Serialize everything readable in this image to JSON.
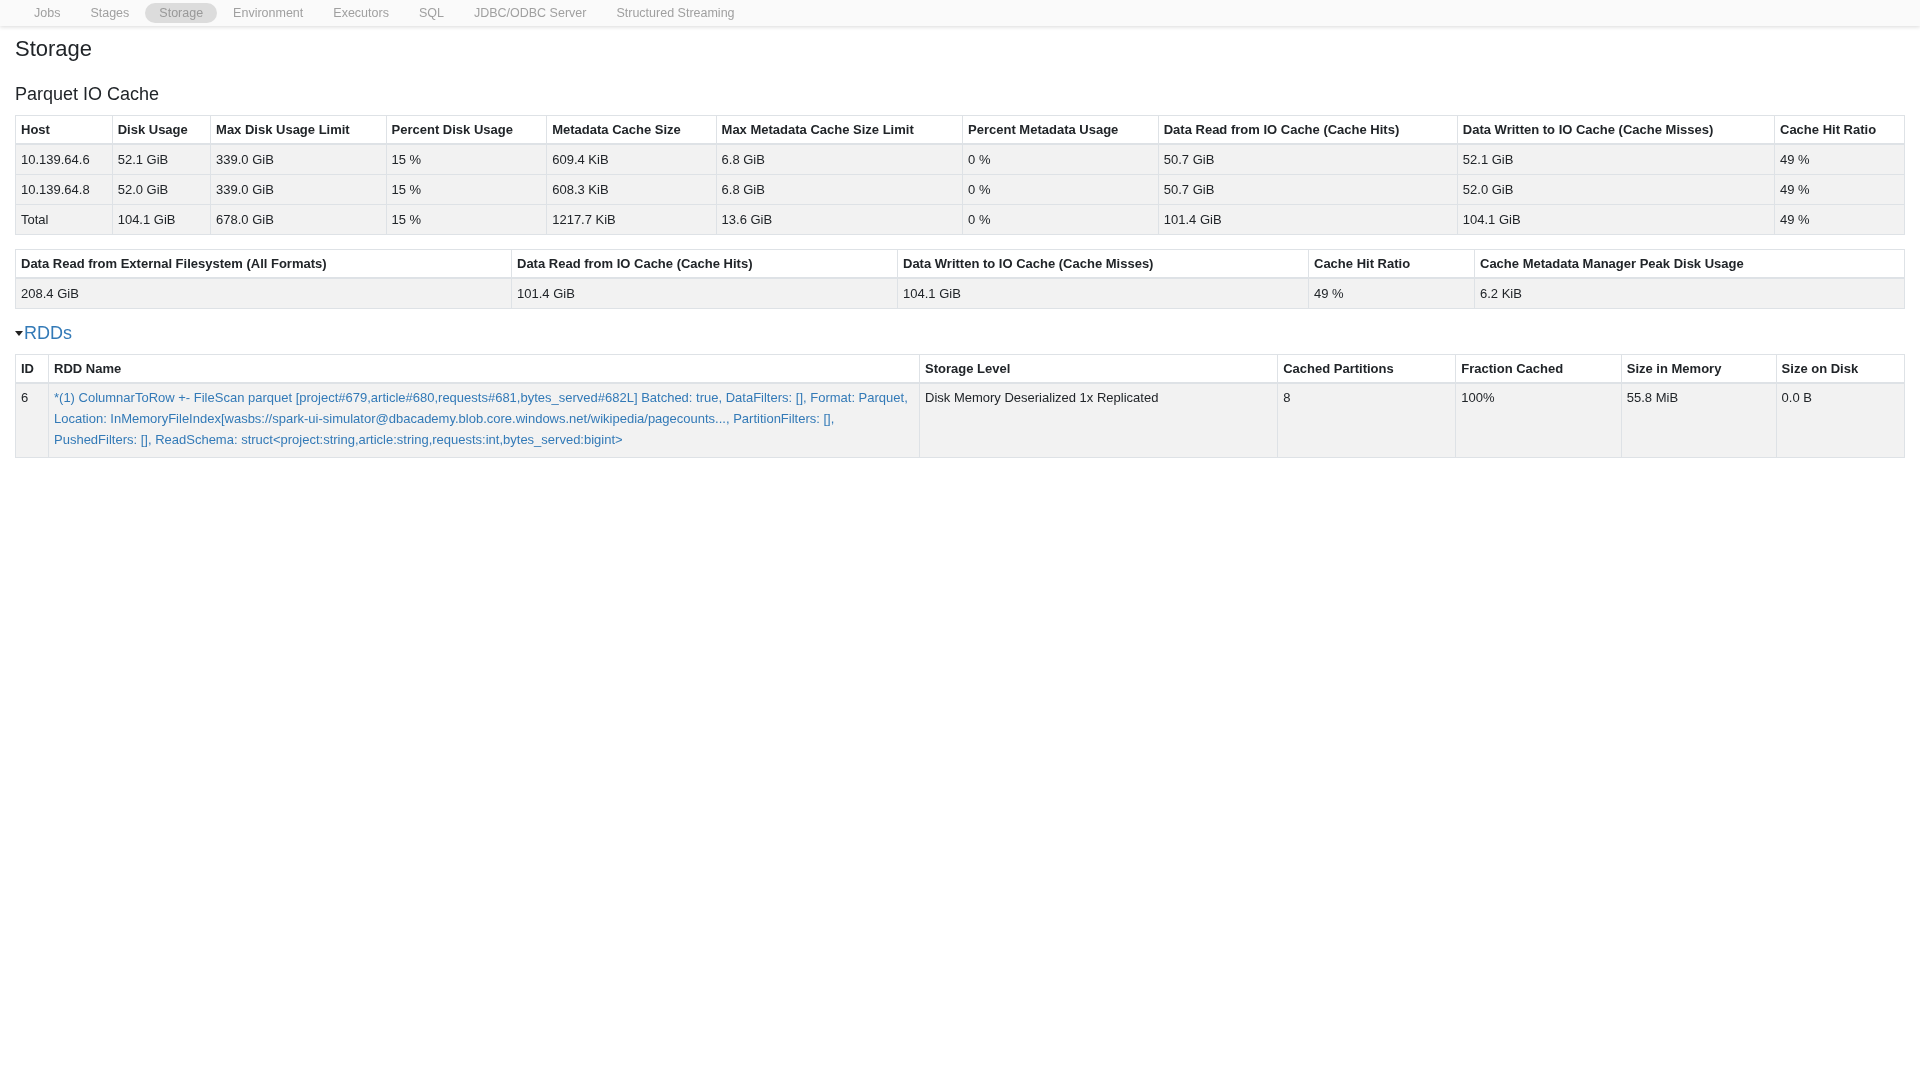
{
  "nav": {
    "tabs": [
      {
        "label": "Jobs",
        "selected": false
      },
      {
        "label": "Stages",
        "selected": false
      },
      {
        "label": "Storage",
        "selected": true
      },
      {
        "label": "Environment",
        "selected": false
      },
      {
        "label": "Executors",
        "selected": false
      },
      {
        "label": "SQL",
        "selected": false
      },
      {
        "label": "JDBC/ODBC Server",
        "selected": false
      },
      {
        "label": "Structured Streaming",
        "selected": false
      }
    ]
  },
  "title": "Storage",
  "io_cache": {
    "heading": "Parquet IO Cache",
    "table": {
      "columns": [
        "Host",
        "Disk Usage",
        "Max Disk Usage Limit",
        "Percent Disk Usage",
        "Metadata Cache Size",
        "Max Metadata Cache Size Limit",
        "Percent Metadata Usage",
        "Data Read from IO Cache (Cache Hits)",
        "Data Written to IO Cache (Cache Misses)",
        "Cache Hit Ratio"
      ],
      "rows": [
        [
          "10.139.64.6",
          "52.1 GiB",
          "339.0 GiB",
          "15 %",
          "609.4 KiB",
          "6.8 GiB",
          "0 %",
          "50.7 GiB",
          "52.1 GiB",
          "49 %"
        ],
        [
          "10.139.64.8",
          "52.0 GiB",
          "339.0 GiB",
          "15 %",
          "608.3 KiB",
          "6.8 GiB",
          "0 %",
          "50.7 GiB",
          "52.0 GiB",
          "49 %"
        ],
        [
          "Total",
          "104.1 GiB",
          "678.0 GiB",
          "15 %",
          "1217.7 KiB",
          "13.6 GiB",
          "0 %",
          "101.4 GiB",
          "104.1 GiB",
          "49 %"
        ]
      ]
    },
    "summary": {
      "columns": [
        "Data Read from External Filesystem (All Formats)",
        "Data Read from IO Cache (Cache Hits)",
        "Data Written to IO Cache (Cache Misses)",
        "Cache Hit Ratio",
        "Cache Metadata Manager Peak Disk Usage"
      ],
      "rows": [
        [
          "208.4 GiB",
          "101.4 GiB",
          "104.1 GiB",
          "49 %",
          "6.2 KiB"
        ]
      ]
    }
  },
  "rdds": {
    "heading": "RDDs",
    "expanded": true,
    "table": {
      "columns": [
        "ID",
        "RDD Name",
        "Storage Level",
        "Cached Partitions",
        "Fraction Cached",
        "Size in Memory",
        "Size on Disk"
      ],
      "rows": [
        {
          "id": "6",
          "name": "*(1) ColumnarToRow +- FileScan parquet [project#679,article#680,requests#681,bytes_served#682L] Batched: true, DataFilters: [], Format: Parquet, Location: InMemoryFileIndex[wasbs://spark-ui-simulator@dbacademy.blob.core.windows.net/wikipedia/pagecounts..., PartitionFilters: [], PushedFilters: [], ReadSchema: struct<project:string,article:string,requests:int,bytes_served:bigint>",
          "storage_level": "Disk Memory Deserialized 1x Replicated",
          "cached_partitions": "8",
          "fraction_cached": "100%",
          "size_in_memory": "55.8 MiB",
          "size_on_disk": "0.0 B"
        }
      ]
    }
  }
}
